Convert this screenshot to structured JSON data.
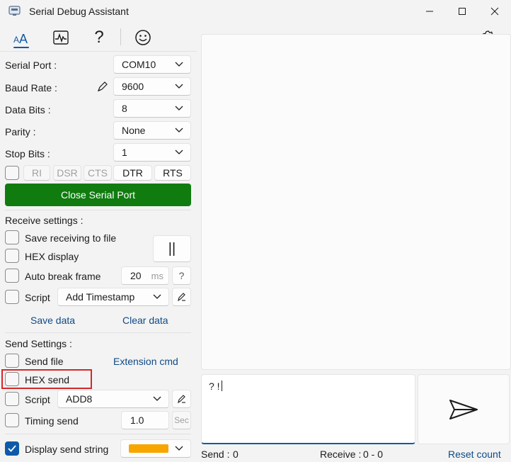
{
  "window": {
    "title": "Serial Debug Assistant"
  },
  "toolbar": {
    "icons": [
      "font-size-icon",
      "waveform-icon",
      "question-icon",
      "smiley-icon",
      "gear-icon"
    ],
    "help_glyph": "?"
  },
  "serial": {
    "port_label": "Serial Port :",
    "port_value": "COM10",
    "baud_label": "Baud Rate :",
    "baud_value": "9600",
    "databits_label": "Data Bits :",
    "databits_value": "8",
    "parity_label": "Parity :",
    "parity_value": "None",
    "stopbits_label": "Stop Bits :",
    "stopbits_value": "1",
    "signals": [
      "RI",
      "DSR",
      "CTS",
      "DTR",
      "RTS"
    ],
    "close_label": "Close Serial Port",
    "close_color": "#107c10"
  },
  "receive": {
    "header": "Receive settings :",
    "save_file": "Save receiving to file",
    "hex_display": "HEX display",
    "pause_label": "||",
    "auto_break": "Auto break frame",
    "break_value": "20",
    "break_unit": "ms",
    "help": "?",
    "script_label": "Script",
    "script_value": "Add Timestamp",
    "save_data": "Save data",
    "clear_data": "Clear data"
  },
  "send": {
    "header": "Send Settings :",
    "send_file": "Send file",
    "extension_cmd": "Extension cmd",
    "hex_send": "HEX send",
    "script_label": "Script",
    "script_value": "ADD8",
    "timing_send": "Timing send",
    "timing_value": "1.0",
    "timing_unit": "Sec",
    "display_send": "Display send string",
    "display_checked": true,
    "color_swatch": "#f7a600",
    "input_text": "? !"
  },
  "status": {
    "send_label": "Send :",
    "send_count": "0",
    "receive_label": "Receive :",
    "receive_count": "0 - 0",
    "reset": "Reset count"
  },
  "colors": {
    "accent": "#0f5aa8",
    "highlight": "#d62828"
  }
}
